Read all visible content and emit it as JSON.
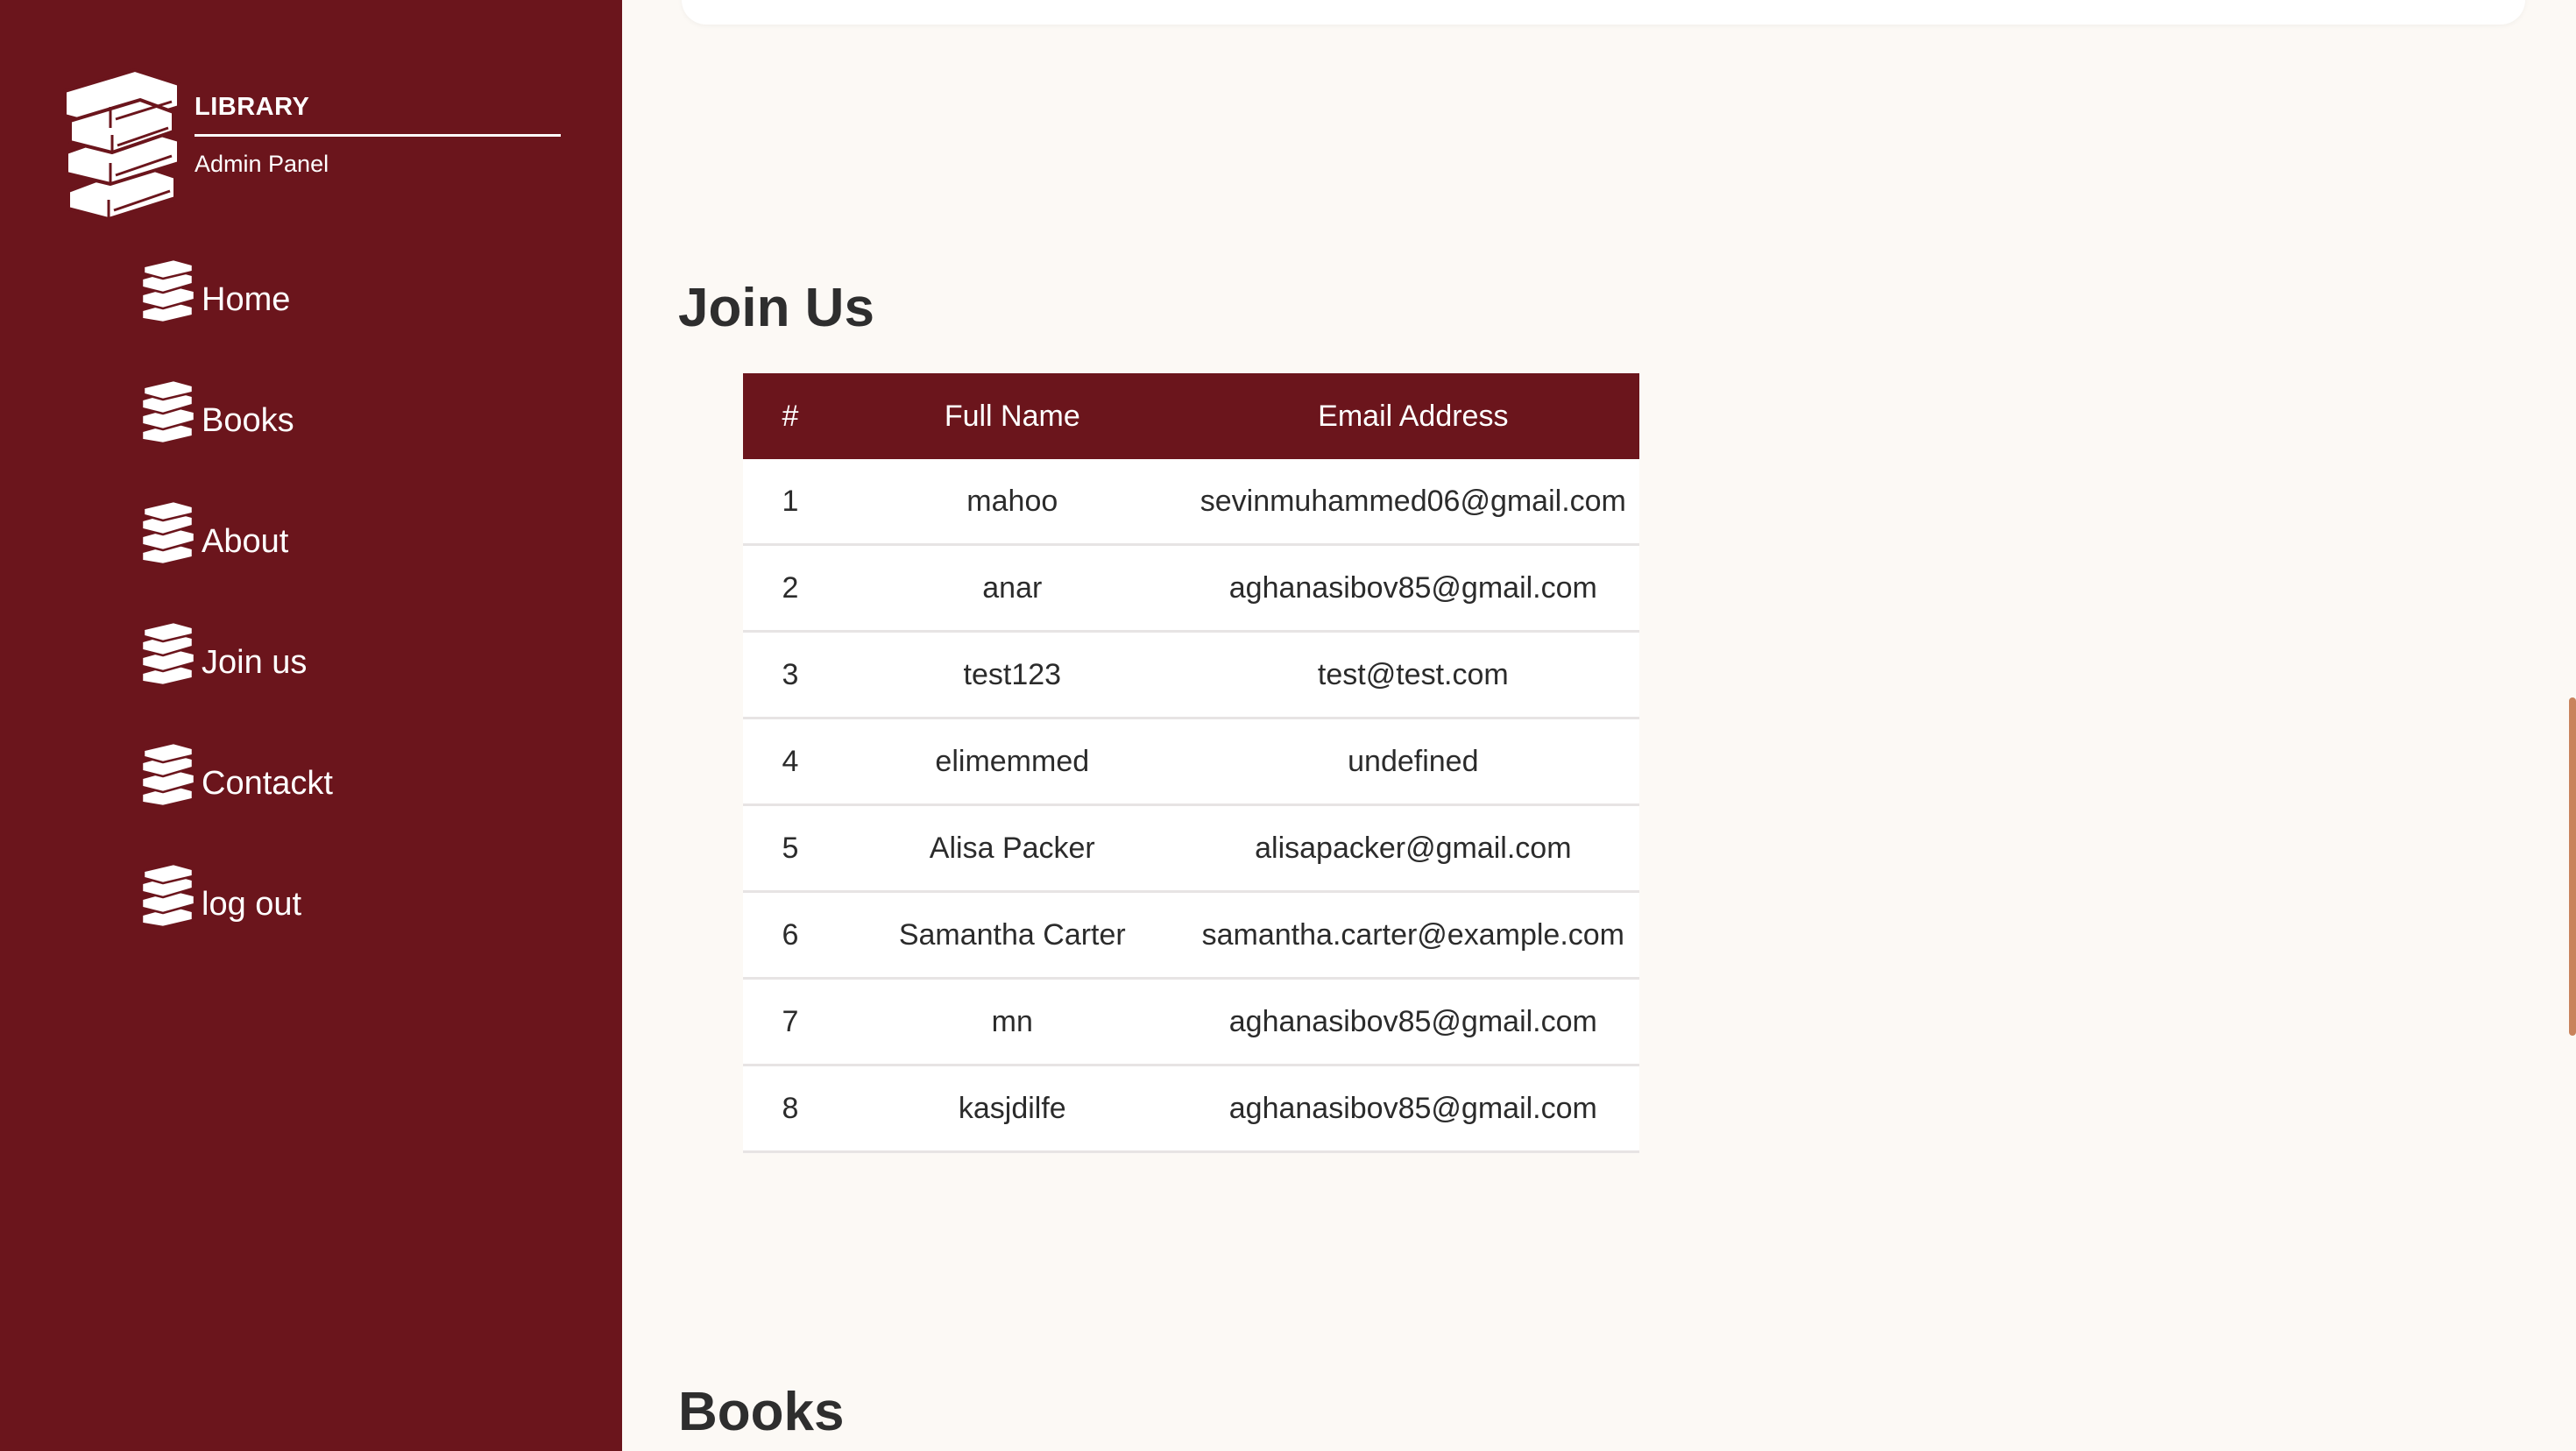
{
  "brand": {
    "title": "LIBRARY",
    "subtitle": "Admin Panel"
  },
  "nav": [
    {
      "label": "Home",
      "icon": "books-icon"
    },
    {
      "label": "Books",
      "icon": "books-icon"
    },
    {
      "label": "About",
      "icon": "books-icon"
    },
    {
      "label": "Join us",
      "icon": "books-icon"
    },
    {
      "label": "Contackt",
      "icon": "books-icon"
    },
    {
      "label": "log out",
      "icon": "books-icon"
    }
  ],
  "join": {
    "title": "Join Us",
    "columns": [
      "#",
      "Full Name",
      "Email Address"
    ],
    "rows": [
      {
        "n": "1",
        "name": "mahoo",
        "email": "sevinmuhammed06@gmail.com"
      },
      {
        "n": "2",
        "name": "anar",
        "email": "aghanasibov85@gmail.com"
      },
      {
        "n": "3",
        "name": "test123",
        "email": "test@test.com"
      },
      {
        "n": "4",
        "name": "elimemmed",
        "email": "undefined"
      },
      {
        "n": "5",
        "name": "Alisa Packer",
        "email": "alisapacker@gmail.com"
      },
      {
        "n": "6",
        "name": "Samantha Carter",
        "email": "samantha.carter@example.com"
      },
      {
        "n": "7",
        "name": "mn",
        "email": "aghanasibov85@gmail.com"
      },
      {
        "n": "8",
        "name": "kasjdilfe",
        "email": "aghanasibov85@gmail.com"
      }
    ]
  },
  "books": {
    "title": "Books"
  },
  "colors": {
    "sidebar": "#6b151c",
    "page_bg": "#fcf9f5",
    "accent": "#c9835c"
  }
}
